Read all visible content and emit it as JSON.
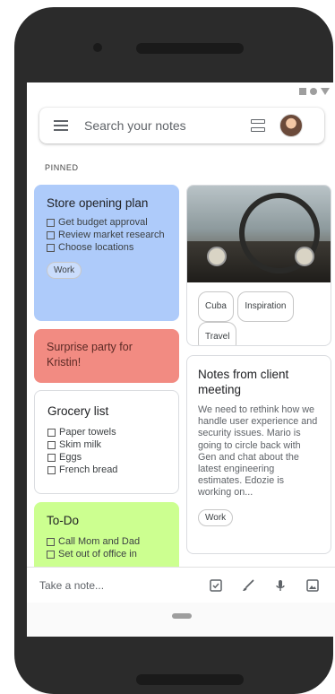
{
  "search": {
    "placeholder": "Search your notes"
  },
  "section": {
    "pinned_label": "PINNED"
  },
  "notes": {
    "store": {
      "title": "Store opening plan",
      "items": [
        "Get budget approval",
        "Review market research",
        "Choose locations"
      ],
      "label": "Work",
      "color": "#aecbfa"
    },
    "party": {
      "title": "Surprise party for Kristin!",
      "color": "#f28b82"
    },
    "grocery": {
      "title": "Grocery list",
      "items": [
        "Paper towels",
        "Skim milk",
        "Eggs",
        "French bread"
      ]
    },
    "todo": {
      "title": "To-Do",
      "items": [
        "Call Mom and Dad",
        "Set out of office in"
      ],
      "color": "#ccff90"
    },
    "photo": {
      "labels": [
        "Cuba",
        "Inspiration",
        "Travel"
      ]
    },
    "client": {
      "title": "Notes from client meeting",
      "body": "We need to rethink how we handle user experience and security issues. Mario is going to circle back with Gen and chat about the latest engineering estimates. Edozie is working on...",
      "label": "Work"
    }
  },
  "bottom_bar": {
    "take_note": "Take a note..."
  },
  "icons": [
    "menu-icon",
    "grid-view-icon",
    "avatar",
    "checkbox-icon",
    "brush-icon",
    "microphone-icon",
    "image-icon"
  ]
}
